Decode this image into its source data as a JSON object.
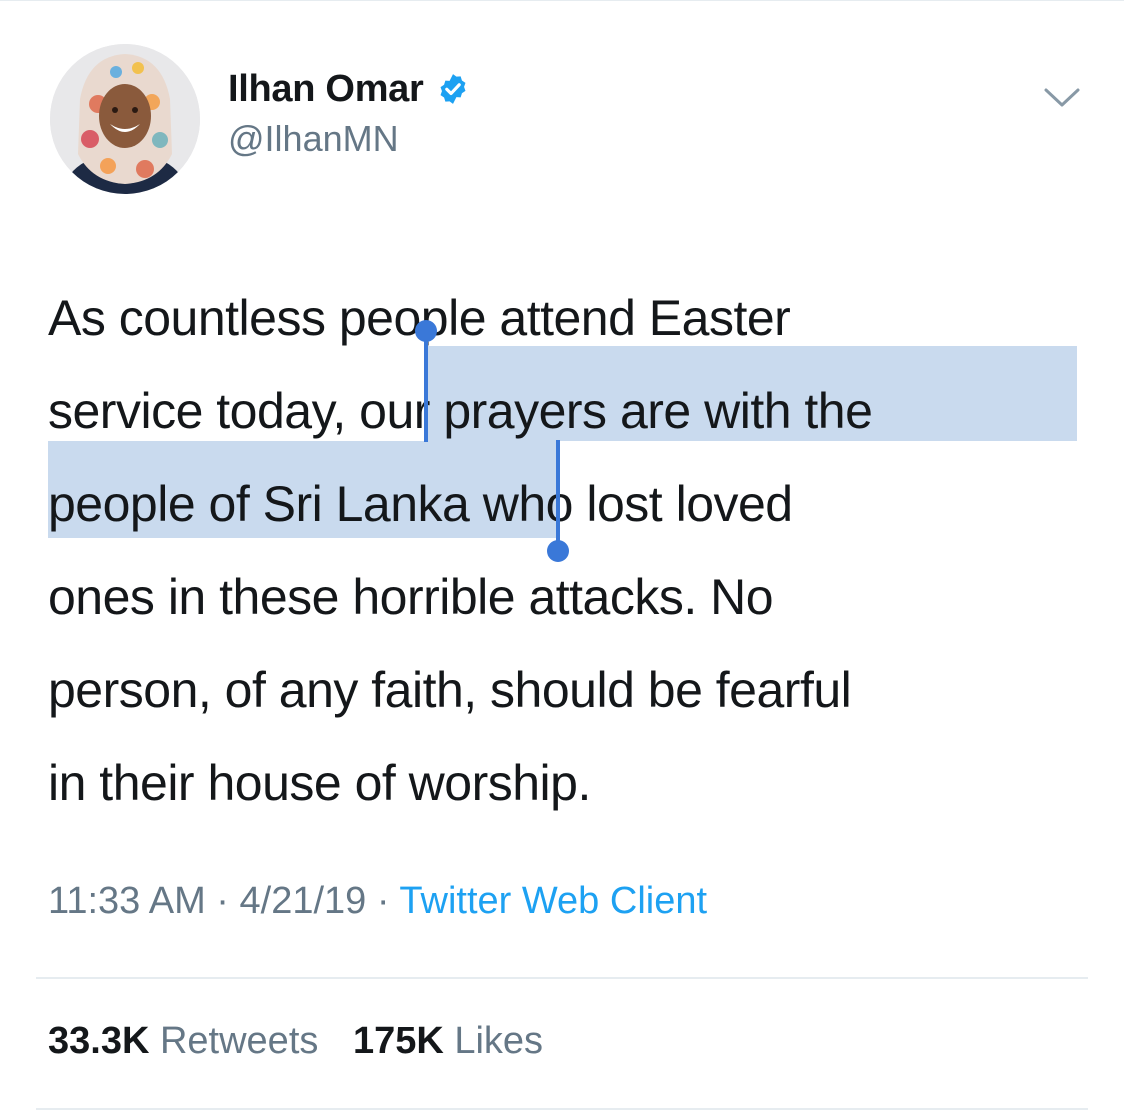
{
  "author": {
    "display_name": "Ilhan Omar",
    "handle": "@IlhanMN",
    "verified_icon": "verified-badge-icon",
    "verified_color": "#1da1f2"
  },
  "menu_icon": "chevron-down-icon",
  "tweet": {
    "lines": [
      {
        "text": "As countless people attend Easter"
      },
      {
        "pre": "service today,",
        "sel": "our prayers are with the"
      },
      {
        "sel": "people of Sri Lanka",
        "post": "who lost loved"
      },
      {
        "text": "ones in these horrible attacks. No"
      },
      {
        "text": "person, of any faith, should be fearful"
      },
      {
        "text": "in their house of worship."
      }
    ],
    "selection_color": "#c9daee",
    "selection_handle_color": "#3a78d8"
  },
  "meta": {
    "time": "11:33 AM",
    "sep": "·",
    "date": "4/21/19",
    "source": "Twitter Web Client"
  },
  "stats": {
    "retweets_count": "33.3K",
    "retweets_label": "Retweets",
    "likes_count": "175K",
    "likes_label": "Likes"
  },
  "colors": {
    "text": "#14171a",
    "secondary": "#657786",
    "link": "#1da1f2",
    "divider": "#e6ecf0"
  }
}
